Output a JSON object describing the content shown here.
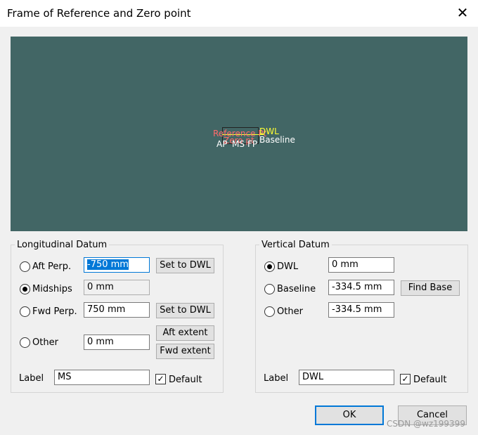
{
  "window": {
    "title": "Frame of Reference and Zero point",
    "close_glyph": "✕"
  },
  "preview": {
    "label_reference": "Reference Pt",
    "label_zero": "Zero pt",
    "label_dwl": "DWL",
    "label_baseline": "Baseline",
    "label_ap": "AP",
    "label_ms": "MS",
    "label_fp": "FP",
    "background_color": "#426665"
  },
  "longitudinal": {
    "legend": "Longitudinal Datum",
    "aft_perp_label": "Aft Perp.",
    "aft_perp_value": "-750 mm",
    "midships_label": "Midships",
    "midships_value": "0 mm",
    "fwd_perp_label": "Fwd Perp.",
    "fwd_perp_value": "750 mm",
    "other_label": "Other",
    "other_value": "0 mm",
    "set_to_dwl_1": "Set to DWL",
    "set_to_dwl_2": "Set to DWL",
    "aft_extent": "Aft extent",
    "fwd_extent": "Fwd extent",
    "label_caption": "Label",
    "label_value": "MS",
    "default_label": "Default",
    "selected": "Midships"
  },
  "vertical": {
    "legend": "Vertical Datum",
    "dwl_label": "DWL",
    "dwl_value": "0 mm",
    "baseline_label": "Baseline",
    "baseline_value": "-334.5 mm",
    "find_base": "Find Base",
    "other_label": "Other",
    "other_value": "-334.5 mm",
    "label_caption": "Label",
    "label_value": "DWL",
    "default_label": "Default",
    "selected": "DWL"
  },
  "buttons": {
    "ok": "OK",
    "cancel": "Cancel"
  },
  "watermark": "CSDN @wz199399"
}
